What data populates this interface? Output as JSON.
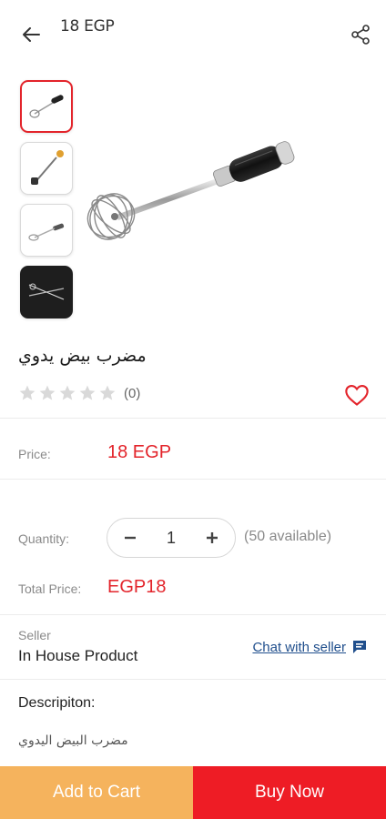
{
  "header": {
    "title": "18 EGP",
    "back_icon": "arrow-left-icon",
    "share_icon": "share-icon"
  },
  "gallery": {
    "thumbnails": [
      "whisk-thumb-1",
      "whisk-thumb-2",
      "whisk-thumb-3",
      "whisk-thumb-4"
    ],
    "active_index": 0
  },
  "product": {
    "title": "مضرب بيض يدوي",
    "rating_stars": 0,
    "rating_count": "(0)"
  },
  "price": {
    "label": "Price:",
    "value": "18 EGP"
  },
  "quantity": {
    "label": "Quantity:",
    "value": "1",
    "available": "(50 available)"
  },
  "total": {
    "label": "Total Price:",
    "value": "EGP18"
  },
  "seller": {
    "label": "Seller",
    "name": "In House Product",
    "chat_label": "Chat with seller"
  },
  "description": {
    "title": "Descripiton:",
    "text": "مضرب البيض اليدوي"
  },
  "actions": {
    "add_to_cart": "Add to Cart",
    "buy_now": "Buy Now"
  },
  "colors": {
    "accent": "#e3242b",
    "cart": "#f5b35d",
    "buy": "#ee1c25",
    "link": "#1f4e8c"
  }
}
